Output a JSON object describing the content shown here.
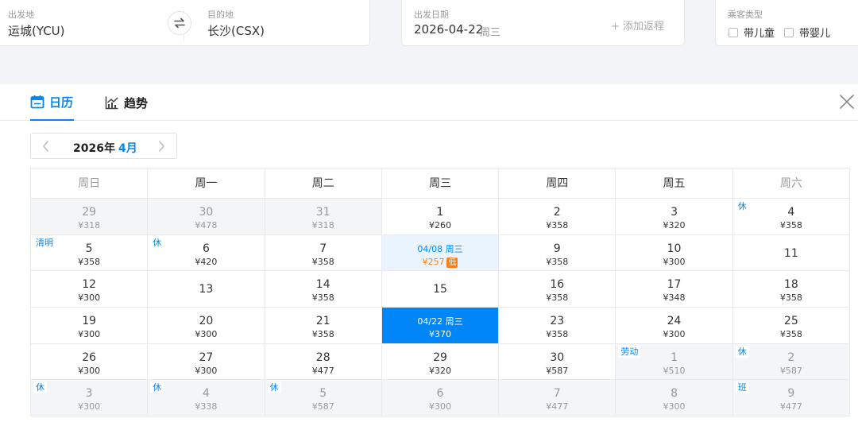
{
  "search": {
    "from_label": "出发地",
    "from_value": "运城(YCU)",
    "to_label": "目的地",
    "to_value": "长沙(CSX)",
    "date_label": "出发日期",
    "date_value": "2026-04-22",
    "date_weekday": "周三",
    "add_return": "+ 添加返程",
    "passenger_label": "乘客类型",
    "child_label": "带儿童",
    "infant_label": "带婴儿",
    "swap_icon": "swap-arrows-icon"
  },
  "tabs": {
    "calendar_label": "日历",
    "calendar_icon": "calendar-icon",
    "trend_label": "趋势",
    "trend_icon": "trend-chart-icon",
    "close_icon": "close-icon"
  },
  "month_nav": {
    "year": "2026年",
    "month": "4月",
    "prev_icon": "chevron-left-icon",
    "next_icon": "chevron-right-icon"
  },
  "colors": {
    "accent": "#0086f6",
    "low_price": "#ff7d13",
    "muted_bg": "#f4f5f7"
  },
  "weekdays": [
    "周日",
    "周一",
    "周二",
    "周三",
    "周四",
    "周五",
    "周六"
  ],
  "weeks": [
    [
      {
        "day": "29",
        "price": "¥318",
        "muted": true
      },
      {
        "day": "30",
        "price": "¥478",
        "muted": true
      },
      {
        "day": "31",
        "price": "¥318",
        "muted": true
      },
      {
        "day": "1",
        "price": "¥260"
      },
      {
        "day": "2",
        "price": "¥358"
      },
      {
        "day": "3",
        "price": "¥320"
      },
      {
        "day": "4",
        "price": "¥358",
        "tag": "休"
      }
    ],
    [
      {
        "day": "5",
        "price": "¥358",
        "tag": "清明"
      },
      {
        "day": "6",
        "price": "¥420",
        "tag": "休"
      },
      {
        "day": "7",
        "price": "¥358"
      },
      {
        "day": "04/08 周三",
        "price": "¥257",
        "lowest": true,
        "low_label": "低"
      },
      {
        "day": "9",
        "price": "¥358"
      },
      {
        "day": "10",
        "price": "¥300"
      },
      {
        "day": "11",
        "price": ""
      }
    ],
    [
      {
        "day": "12",
        "price": "¥300"
      },
      {
        "day": "13",
        "price": ""
      },
      {
        "day": "14",
        "price": "¥358"
      },
      {
        "day": "15",
        "price": ""
      },
      {
        "day": "16",
        "price": "¥358"
      },
      {
        "day": "17",
        "price": "¥348"
      },
      {
        "day": "18",
        "price": "¥358"
      }
    ],
    [
      {
        "day": "19",
        "price": "¥300"
      },
      {
        "day": "20",
        "price": "¥300"
      },
      {
        "day": "21",
        "price": "¥358"
      },
      {
        "day": "04/22 周三",
        "price": "¥370",
        "selected": true
      },
      {
        "day": "23",
        "price": "¥358"
      },
      {
        "day": "24",
        "price": "¥300"
      },
      {
        "day": "25",
        "price": "¥358"
      }
    ],
    [
      {
        "day": "26",
        "price": "¥300"
      },
      {
        "day": "27",
        "price": "¥300"
      },
      {
        "day": "28",
        "price": "¥477"
      },
      {
        "day": "29",
        "price": "¥320"
      },
      {
        "day": "30",
        "price": "¥587"
      },
      {
        "day": "1",
        "price": "¥510",
        "muted": true,
        "tag": "劳动"
      },
      {
        "day": "2",
        "price": "¥587",
        "muted": true,
        "tag": "休"
      }
    ],
    [
      {
        "day": "3",
        "price": "¥300",
        "muted": true,
        "tag": "休"
      },
      {
        "day": "4",
        "price": "¥338",
        "muted": true,
        "tag": "休"
      },
      {
        "day": "5",
        "price": "¥587",
        "muted": true,
        "tag": "休"
      },
      {
        "day": "6",
        "price": "¥300",
        "muted": true
      },
      {
        "day": "7",
        "price": "¥477",
        "muted": true
      },
      {
        "day": "8",
        "price": "¥300",
        "muted": true
      },
      {
        "day": "9",
        "price": "¥477",
        "muted": true,
        "tag": "班"
      }
    ]
  ]
}
